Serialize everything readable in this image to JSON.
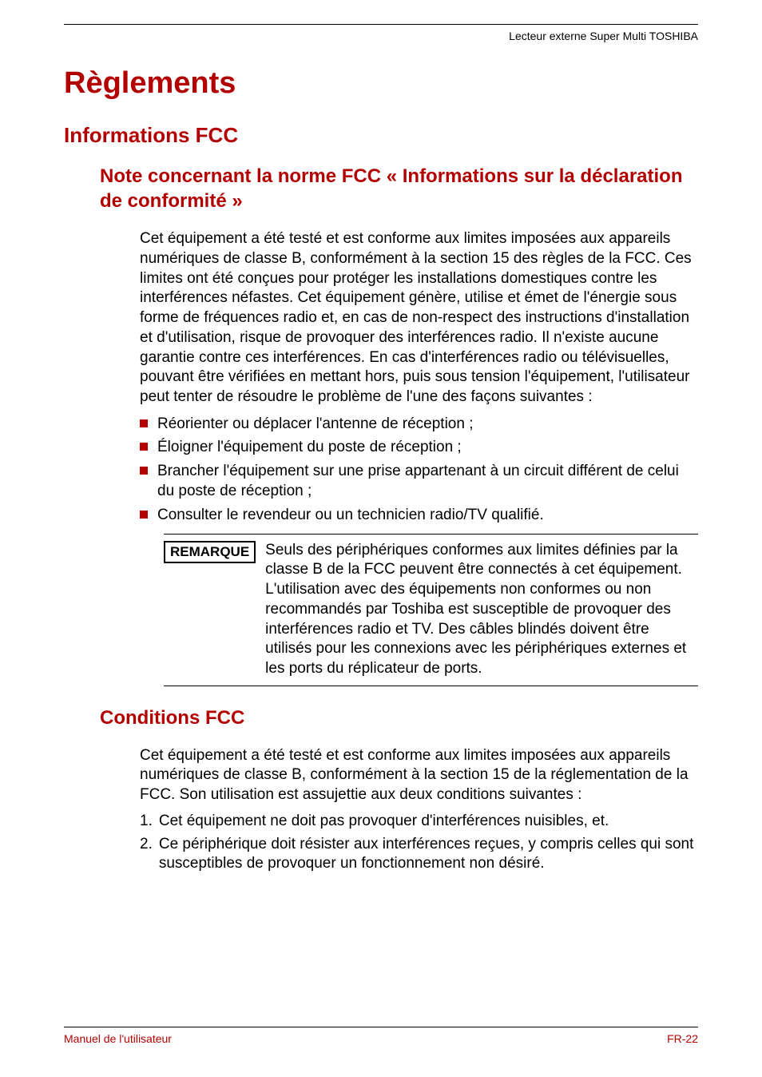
{
  "header": {
    "product": "Lecteur externe Super Multi TOSHIBA"
  },
  "title": "Règlements",
  "section1": {
    "heading": "Informations FCC",
    "sub1": {
      "heading": "Note concernant la norme FCC « Informations sur la déclaration de conformité »",
      "paragraph": "Cet équipement a été testé et est conforme aux limites imposées aux appareils numériques de classe B, conformément à la section 15 des règles de la FCC. Ces limites ont été conçues pour protéger les installations domestiques contre les interférences néfastes. Cet équipement génère, utilise et émet de l'énergie sous forme de fréquences radio et, en cas de non-respect des instructions d'installation et d'utilisation, risque de provoquer des interférences radio. Il n'existe aucune garantie contre ces interférences. En cas d'interférences radio ou télévisuelles, pouvant être vérifiées en mettant hors, puis sous tension l'équipement, l'utilisateur peut tenter de résoudre le problème de l'une des façons suivantes :",
      "bullets": [
        "Réorienter ou déplacer l'antenne de réception ;",
        "Éloigner l'équipement du poste de réception ;",
        "Brancher l'équipement sur une prise appartenant à un circuit différent de celui du poste de réception ;",
        "Consulter le revendeur ou un technicien radio/TV qualifié."
      ],
      "remark_label": "REMARQUE",
      "remark_text": "Seuls des périphériques conformes aux limites définies par la classe B de la FCC peuvent être connectés à cet équipement. L'utilisation avec des équipements non conformes ou non recommandés par Toshiba est susceptible de provoquer des interférences radio et TV. Des câbles blindés doivent être utilisés pour les connexions avec les périphériques externes et les ports du réplicateur de ports."
    },
    "sub2": {
      "heading": "Conditions FCC",
      "paragraph": "Cet équipement a été testé et est conforme aux limites imposées aux appareils numériques de classe B, conformément à la section 15 de la réglementation de la FCC. Son utilisation est assujettie aux deux conditions suivantes :",
      "numbered": [
        "Cet équipement ne doit pas provoquer d'interférences nuisibles, et.",
        "Ce périphérique doit résister aux interférences reçues, y compris celles qui sont susceptibles de provoquer un fonctionnement non désiré."
      ]
    }
  },
  "footer": {
    "left": "Manuel de l'utilisateur",
    "right": "FR-22"
  }
}
